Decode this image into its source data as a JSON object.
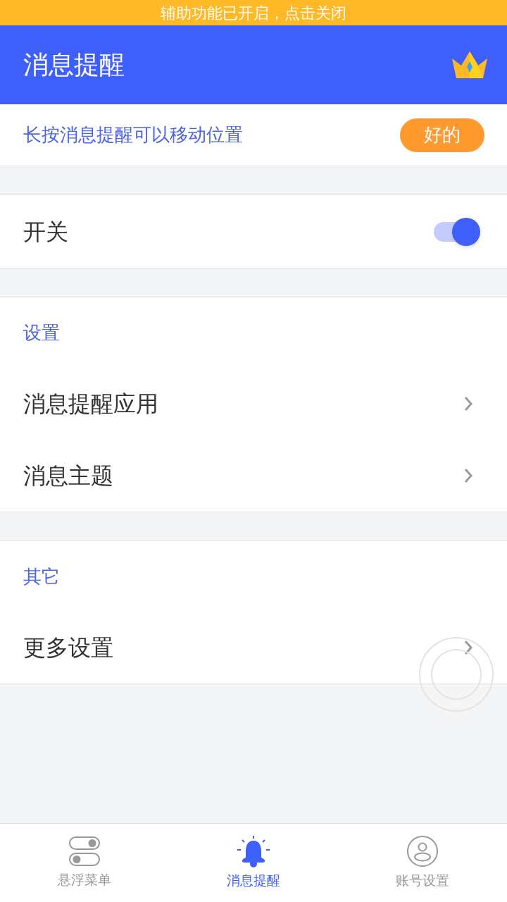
{
  "banner": "辅助功能已开启，点击关闭",
  "header": {
    "title": "消息提醒"
  },
  "hint": {
    "text": "长按消息提醒可以移动位置",
    "button": "好的"
  },
  "switch": {
    "label": "开关",
    "on": true
  },
  "sections": [
    {
      "title": "设置",
      "items": [
        {
          "label": "消息提醒应用"
        },
        {
          "label": "消息主题"
        }
      ]
    },
    {
      "title": "其它",
      "items": [
        {
          "label": "更多设置"
        }
      ]
    }
  ],
  "tabs": [
    {
      "label": "悬浮菜单",
      "kind": "toggles",
      "selected": false
    },
    {
      "label": "消息提醒",
      "kind": "bell",
      "selected": true
    },
    {
      "label": "账号设置",
      "kind": "person",
      "selected": false
    }
  ]
}
